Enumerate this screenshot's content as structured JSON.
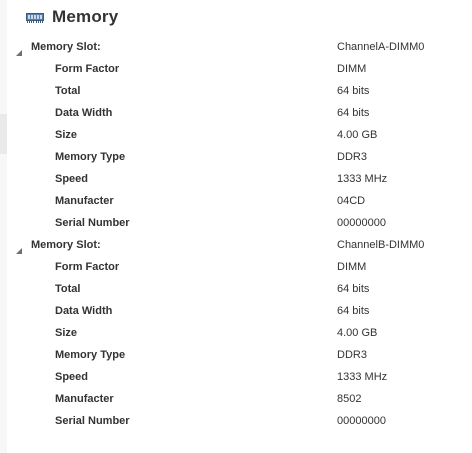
{
  "header": {
    "title": "Memory",
    "icon": "memory-module-icon"
  },
  "slots": [
    {
      "label": "Memory Slot:",
      "value": "ChannelA-DIMM0",
      "props": [
        {
          "key": "Form Factor",
          "value": "DIMM"
        },
        {
          "key": "Total",
          "value": "64 bits"
        },
        {
          "key": "Data Width",
          "value": "64 bits"
        },
        {
          "key": "Size",
          "value": "4.00 GB"
        },
        {
          "key": "Memory Type",
          "value": "DDR3"
        },
        {
          "key": "Speed",
          "value": "1333 MHz"
        },
        {
          "key": "Manufacter",
          "value": "04CD"
        },
        {
          "key": "Serial Number",
          "value": "00000000"
        }
      ]
    },
    {
      "label": "Memory Slot:",
      "value": "ChannelB-DIMM0",
      "props": [
        {
          "key": "Form Factor",
          "value": "DIMM"
        },
        {
          "key": "Total",
          "value": "64 bits"
        },
        {
          "key": "Data Width",
          "value": "64 bits"
        },
        {
          "key": "Size",
          "value": "4.00 GB"
        },
        {
          "key": "Memory Type",
          "value": "DDR3"
        },
        {
          "key": "Speed",
          "value": "1333 MHz"
        },
        {
          "key": "Manufacter",
          "value": "8502"
        },
        {
          "key": "Serial Number",
          "value": "00000000"
        }
      ]
    }
  ]
}
